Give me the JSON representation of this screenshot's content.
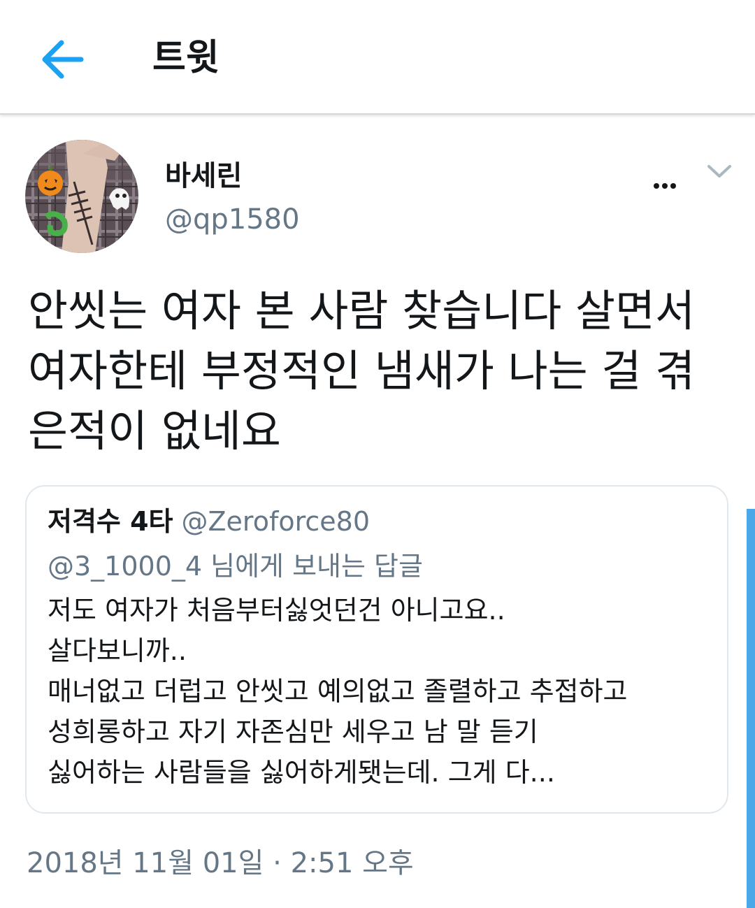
{
  "header": {
    "title": "트윗",
    "back_icon": "arrow-left-icon"
  },
  "tweet": {
    "author_name": "바세린",
    "author_handle": "@qp1580",
    "more_label": "...",
    "text": "안씻는 여자 본 사람 찾습니다 살면서 여자한테 부정적인 냄새가 나는 걸 겪은적이 없네요",
    "timestamp": "2018년 11월 01일 · 2:51 오후"
  },
  "quoted_tweet": {
    "author_name": "저격수 4타",
    "author_handle": "@Zeroforce80",
    "reply_to": "@3_1000_4 님에게 보내는 답글",
    "lines": [
      "저도 여자가 처음부터싫엇던건 아니고요..",
      "살다보니까..",
      "매너없고 더럽고 안씻고 예의없고 졸렬하고 추접하고",
      "성희롱하고 자기 자존심만 세우고 남 말 듣기",
      "싫어하는 사람들을 싫어하게됏는데. 그게 다..."
    ]
  },
  "colors": {
    "accent": "#1da1f2",
    "secondary_text": "#657786",
    "border": "#e1e8ed",
    "scrollbar": "#4aa8e8"
  }
}
